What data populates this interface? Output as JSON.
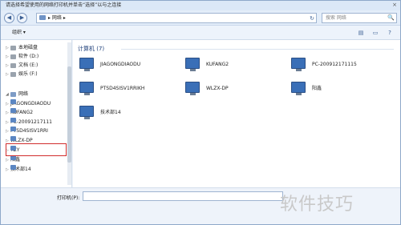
{
  "window": {
    "title": "请选择希望使用的网络打印机并单击“选择”以与之连接",
    "close": "×"
  },
  "address": {
    "back": "◀",
    "forward": "▶",
    "path": "▸ 网络 ▸",
    "refresh": "↻",
    "search_placeholder": "搜索 网络",
    "search_icon": "🔍"
  },
  "toolbar": {
    "organize": "组织 ▾",
    "view": "▤",
    "layout": "▭",
    "help": "?"
  },
  "sidebar": {
    "items": [
      {
        "label": "本地磁盘",
        "icon": "drive-icon"
      },
      {
        "label": "软件 (D:)",
        "icon": "drive-icon"
      },
      {
        "label": "文档 (E:)",
        "icon": "drive-icon"
      },
      {
        "label": "娱乐 (F:)",
        "icon": "drive-icon"
      },
      {
        "label": "网络",
        "icon": "network-icon"
      },
      {
        "label": "JIAGONGDIAODU",
        "icon": "computer-icon"
      },
      {
        "label": "KUFANG2",
        "icon": "computer-icon"
      },
      {
        "label": "PC-20091217111",
        "icon": "computer-icon"
      },
      {
        "label": "PTSD4SISV1RRI",
        "icon": "computer-icon"
      },
      {
        "label": "WLZX-DP",
        "icon": "computer-icon"
      },
      {
        "label": "YZY",
        "icon": "computer-icon"
      },
      {
        "label": "阳鑫",
        "icon": "computer-icon"
      },
      {
        "label": "技术部14",
        "icon": "computer-icon"
      }
    ]
  },
  "main": {
    "group_title": "计算机 (7)",
    "computers": [
      {
        "name": "JIAGONGDIAODU"
      },
      {
        "name": "KUFANG2"
      },
      {
        "name": "PC-200912171115"
      },
      {
        "name": "PTSD4SISV1RRIKH"
      },
      {
        "name": "WLZX-DP"
      },
      {
        "name": "阳鑫"
      },
      {
        "name": "技术部14"
      }
    ]
  },
  "footer": {
    "printer_label": "打印机(P):",
    "printer_value": ""
  },
  "watermark": {
    "text": "软件技巧"
  }
}
